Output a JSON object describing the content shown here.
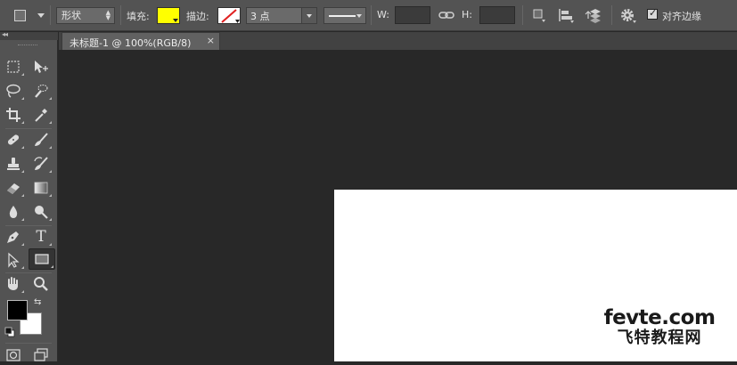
{
  "options_bar": {
    "mode_select": "形状",
    "fill_label": "填充:",
    "stroke_label": "描边:",
    "stroke_size": "3 点",
    "width_label": "W:",
    "height_label": "H:",
    "align_edges_label": "对齐边缘",
    "fill_color": "#ffff00",
    "stroke_color": "none"
  },
  "document_tab": {
    "title": "未标题-1 @ 100%(RGB/8)",
    "close_glyph": "×"
  },
  "toolbox": {
    "collapse_glyph": "◂◂",
    "type_tool_glyph": "T",
    "swap_glyph": "⇆",
    "foreground_color": "#000000",
    "background_color": "#ffffff"
  },
  "watermark": {
    "line1": "fevte.com",
    "line2": "飞特教程网"
  }
}
